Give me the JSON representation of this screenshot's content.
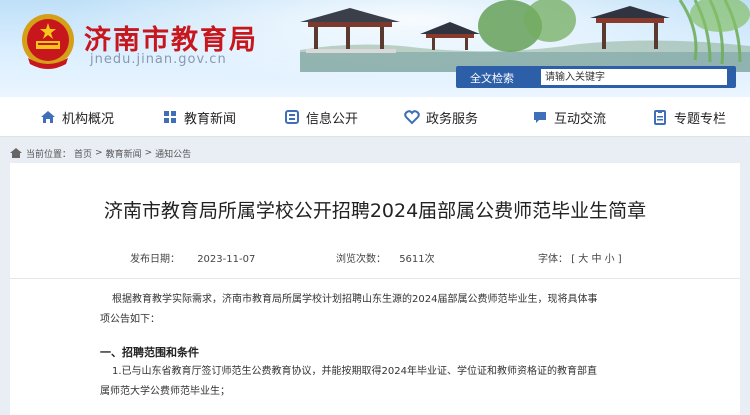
{
  "header": {
    "site_title": "济南市教育局",
    "site_url": "jnedu.jinan.gov.cn",
    "search": {
      "button_label": "全文检索",
      "placeholder": "请输入关键字"
    }
  },
  "nav": {
    "items": [
      {
        "label": "机构概况",
        "icon": "home-icon"
      },
      {
        "label": "教育新闻",
        "icon": "grid-icon"
      },
      {
        "label": "信息公开",
        "icon": "document-icon"
      },
      {
        "label": "政务服务",
        "icon": "heart-icon"
      },
      {
        "label": "互动交流",
        "icon": "chat-icon"
      },
      {
        "label": "专题专栏",
        "icon": "clipboard-icon"
      }
    ]
  },
  "breadcrumb": {
    "prefix": "当前位置：",
    "items": [
      "首页",
      "教育新闻",
      "通知公告"
    ],
    "separator": ">"
  },
  "article": {
    "title": "济南市教育局所属学校公开招聘2024届部属公费师范毕业生简章",
    "publish_label": "发布日期：",
    "publish_date": "2023-11-07",
    "views_label": "浏览次数：",
    "views": "5611次",
    "font_label": "字体：",
    "font_options": "[ 大 中 小 ]",
    "intro_line1": "根据教育教学实际需求，济南市教育局所属学校计划招聘山东生源的2024届部属公费师范毕业生，现将具体事",
    "intro_line2": "项公告如下：",
    "section1_heading": "一、招聘范围和条件",
    "item1_line1": "1.已与山东省教育厅签订师范生公费教育协议，并能按期取得2024年毕业证、学位证和教师资格证的教育部直",
    "item1_line2": "属师范大学公费师范毕业生；"
  }
}
